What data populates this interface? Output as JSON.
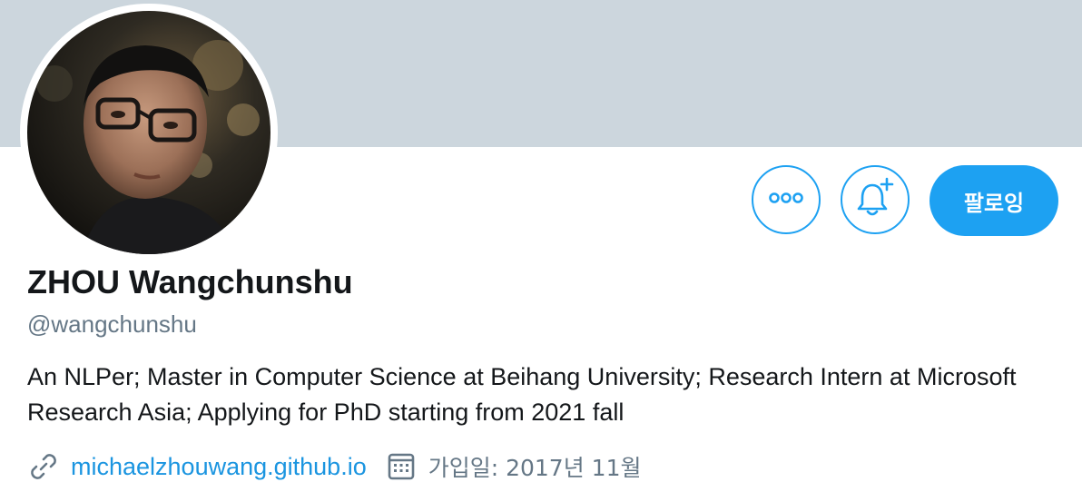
{
  "profile": {
    "display_name": "ZHOU Wangchunshu",
    "handle": "@wangchunshu",
    "bio": "An NLPer; Master in Computer Science at Beihang University; Research Intern at Microsoft Research Asia; Applying for PhD starting from 2021 fall",
    "website": "michaelzhouwang.github.io",
    "joined": "가입일: 2017년 11월"
  },
  "actions": {
    "more_icon": "more-dots-icon",
    "notify_icon": "bell-plus-icon",
    "follow_label": "팔로잉"
  },
  "icons": {
    "website": "link-icon",
    "joined": "calendar-icon"
  },
  "colors": {
    "banner": "#ccd6dd",
    "accent": "#1da1f2",
    "link": "#1b95e0",
    "text_primary": "#14171a",
    "text_secondary": "#657786"
  }
}
